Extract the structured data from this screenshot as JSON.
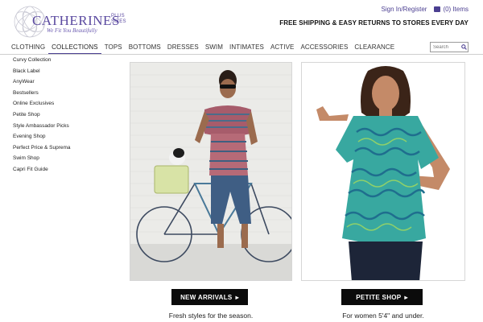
{
  "brand": {
    "name": "CATHERINES",
    "plus_line1": "PLUS",
    "plus_line2": "SIZES",
    "tagline": "We Fit You Beautifully",
    "color": "#5b4aa0"
  },
  "utility": {
    "signin": "Sign In/Register",
    "cart": "(0) Items",
    "cart_icon": "shopping-bag-icon"
  },
  "promo": "FREE SHIPPING & EASY RETURNS TO STORES EVERY DAY",
  "nav": {
    "items": [
      "CLOTHING",
      "COLLECTIONS",
      "TOPS",
      "BOTTOMS",
      "DRESSES",
      "SWIM",
      "INTIMATES",
      "ACTIVE",
      "ACCESSORIES",
      "CLEARANCE"
    ],
    "active": "COLLECTIONS",
    "search_placeholder": "Search",
    "search_icon": "magnifier-icon"
  },
  "sidebar": {
    "items": [
      "Curvy Collection",
      "Black Label",
      "AnyWear",
      "Bestsellers",
      "Online Exclusives",
      "Petite Shop",
      "Style Ambassador Picks",
      "Evening Shop",
      "Perfect Price & Suprema",
      "Swim Shop",
      "Capri Fit Guide"
    ]
  },
  "tiles": [
    {
      "cta": "NEW ARRIVALS",
      "arrow": "▸",
      "caption": "Fresh styles for the season."
    },
    {
      "cta": "PETITE SHOP",
      "arrow": "▸",
      "caption": "For women 5'4\" and under."
    }
  ],
  "colors": {
    "accent": "#4b3f91",
    "cta_bg": "#0b0b0b"
  }
}
